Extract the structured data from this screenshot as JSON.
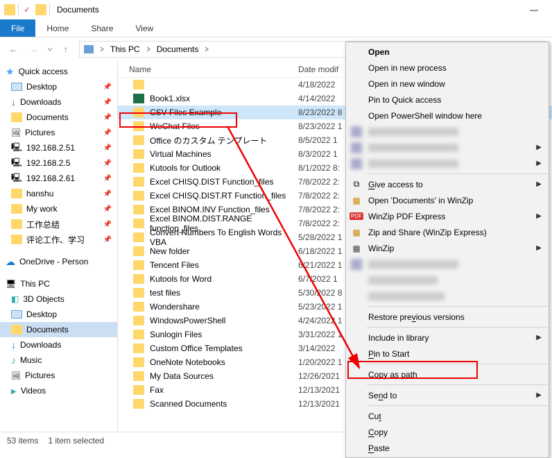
{
  "titlebar": {
    "title": "Documents",
    "minimize": "—"
  },
  "ribbon": {
    "file": "File",
    "home": "Home",
    "share": "Share",
    "view": "View"
  },
  "nav": {
    "back": "←",
    "forward": "→",
    "up": "↑"
  },
  "address": {
    "pc": "This PC",
    "docs": "Documents"
  },
  "sidebar": {
    "quick": "Quick access",
    "items1": [
      {
        "label": "Desktop",
        "icon": "ic-desktop"
      },
      {
        "label": "Downloads",
        "icon": "ic-dl"
      },
      {
        "label": "Documents",
        "icon": "ic-folder"
      },
      {
        "label": "Pictures",
        "icon": "ic-pic"
      },
      {
        "label": "192.168.2.51",
        "icon": "ic-net"
      },
      {
        "label": "192.168.2.5",
        "icon": "ic-net"
      },
      {
        "label": "192.168.2.61",
        "icon": "ic-net"
      },
      {
        "label": "hanshu",
        "icon": "ic-folder"
      },
      {
        "label": "My work",
        "icon": "ic-folder"
      },
      {
        "label": "工作总结",
        "icon": "ic-folder"
      },
      {
        "label": "评论工作、学习",
        "icon": "ic-folder"
      }
    ],
    "onedrive": "OneDrive - Person",
    "thispc": "This PC",
    "items2": [
      {
        "label": "3D Objects",
        "icon": "ic-3d"
      },
      {
        "label": "Desktop",
        "icon": "ic-desktop"
      },
      {
        "label": "Documents",
        "icon": "ic-folder",
        "sel": true
      },
      {
        "label": "Downloads",
        "icon": "ic-dl"
      },
      {
        "label": "Music",
        "icon": "ic-music"
      },
      {
        "label": "Pictures",
        "icon": "ic-pic"
      },
      {
        "label": "Videos",
        "icon": "ic-video"
      }
    ]
  },
  "columns": {
    "name": "Name",
    "date": "Date modif"
  },
  "files": [
    {
      "name": "",
      "date": "4/18/2022",
      "blur": true,
      "xl": false
    },
    {
      "name": "Book1.xlsx",
      "date": "4/14/2022",
      "xl": true
    },
    {
      "name": "CSV Files Example",
      "date": "8/23/2022 8",
      "sel": true
    },
    {
      "name": "WeChat Files",
      "date": "8/23/2022 1"
    },
    {
      "name": "Office のカスタム テンプレート",
      "date": "8/5/2022 1"
    },
    {
      "name": "Virtual Machines",
      "date": "8/3/2022 1"
    },
    {
      "name": "Kutools for Outlook",
      "date": "8/1/2022 8:"
    },
    {
      "name": "Excel CHISQ.DIST Function_files",
      "date": "7/8/2022 2:"
    },
    {
      "name": "Excel CHISQ.DIST.RT Function_files",
      "date": "7/8/2022 2:"
    },
    {
      "name": "Excel BINOM.INV Function_files",
      "date": "7/8/2022 2:"
    },
    {
      "name": "Excel BINOM.DIST.RANGE function_files",
      "date": "7/8/2022 2:"
    },
    {
      "name": "Convert Numbers To English Words VBA",
      "date": "5/28/2022 1"
    },
    {
      "name": "New folder",
      "date": "6/18/2022 1"
    },
    {
      "name": "Tencent Files",
      "date": "6/21/2022 1"
    },
    {
      "name": "Kutools for Word",
      "date": "6/7/2022 1"
    },
    {
      "name": "test files",
      "date": "5/30/2022 8"
    },
    {
      "name": "Wondershare",
      "date": "5/23/2022 1"
    },
    {
      "name": "WindowsPowerShell",
      "date": "4/24/2022 1"
    },
    {
      "name": "Sunlogin Files",
      "date": "3/31/2022 1"
    },
    {
      "name": "Custom Office Templates",
      "date": "3/14/2022"
    },
    {
      "name": "OneNote Notebooks",
      "date": "1/20/2022 1"
    },
    {
      "name": "My Data Sources",
      "date": "12/26/2021"
    },
    {
      "name": "Fax",
      "date": "12/13/2021"
    },
    {
      "name": "Scanned Documents",
      "date": "12/13/2021"
    }
  ],
  "status": {
    "items": "53 items",
    "selected": "1 item selected"
  },
  "ctx": {
    "open": "Open",
    "open_new_process": "Open in new process",
    "open_new_window": "Open in new window",
    "pin_quick": "Pin to Quick access",
    "open_ps": "Open PowerShell window here",
    "give_access": "Give access to",
    "open_winzip": "Open 'Documents' in WinZip",
    "pdf_express": "WinZip PDF Express",
    "zip_share": "Zip and Share (WinZip Express)",
    "winzip": "WinZip",
    "restore": "Restore previous versions",
    "include_lib": "Include in library",
    "pin_start": "Pin to Start",
    "copy_path": "Copy as path",
    "send_to": "Send to",
    "cut": "Cut",
    "copy": "Copy",
    "paste": "Paste"
  }
}
